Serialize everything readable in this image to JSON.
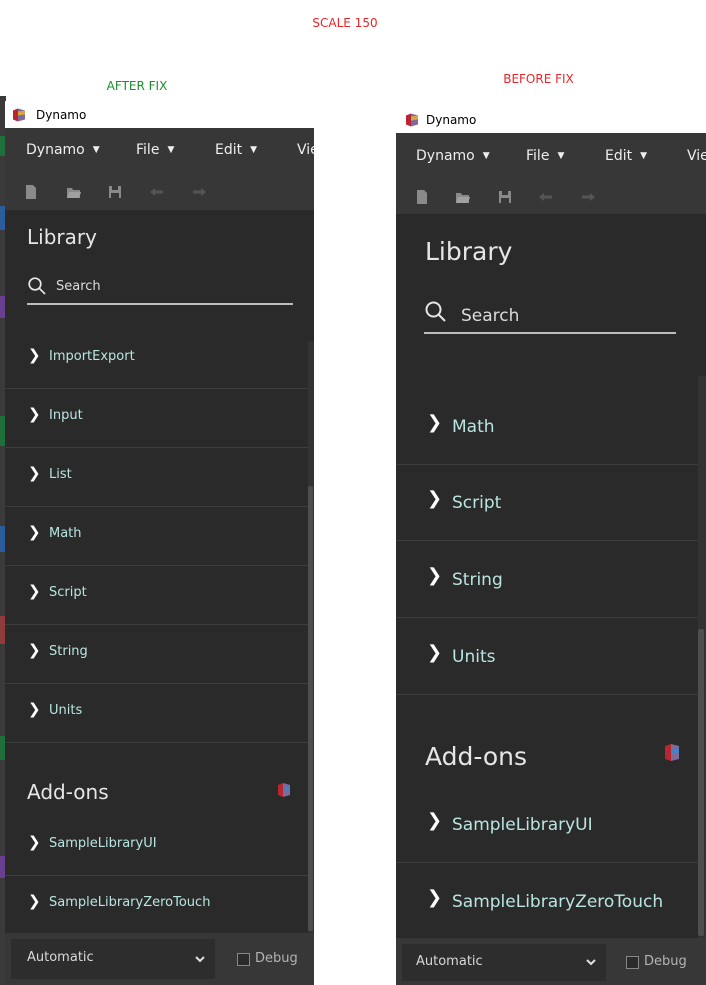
{
  "header": {
    "scale_label": "SCALE 150",
    "after_label": "AFTER FIX",
    "before_label": "BEFORE FIX",
    "scale_color": "#e8262a",
    "after_color": "#1a8f2b",
    "before_color": "#e8262a"
  },
  "colors": {
    "panel_bg": "#2a2a2a",
    "bar_bg": "#373737",
    "category_text": "#b9e5e1",
    "title_text": "#e6e6e6"
  },
  "after_fix": {
    "window_title": "Dynamo",
    "menu": [
      "Dynamo",
      "File",
      "Edit",
      "Vie"
    ],
    "library_title": "Library",
    "search_placeholder": "Search",
    "categories": [
      "ImportExport",
      "Input",
      "List",
      "Math",
      "Script",
      "String",
      "Units"
    ],
    "addons_title": "Add-ons",
    "addons": [
      "SampleLibraryUI",
      "SampleLibraryZeroTouch"
    ],
    "run_mode": "Automatic",
    "debug_label": "Debug"
  },
  "before_fix": {
    "window_title": "Dynamo",
    "menu": [
      "Dynamo",
      "File",
      "Edit",
      "Vie"
    ],
    "library_title": "Library",
    "search_placeholder": "Search",
    "categories": [
      "Math",
      "Script",
      "String",
      "Units"
    ],
    "addons_title": "Add-ons",
    "addons": [
      "SampleLibraryUI",
      "SampleLibraryZeroTouch"
    ],
    "run_mode": "Automatic",
    "debug_label": "Debug"
  }
}
